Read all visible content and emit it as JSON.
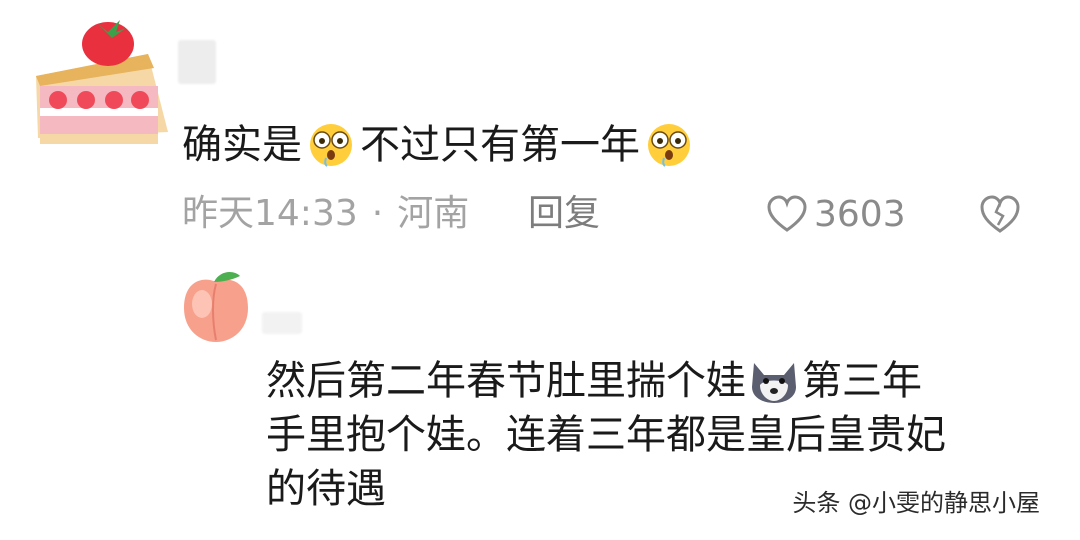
{
  "comment": {
    "avatar_icon": "strawberry-cake-icon",
    "text_parts": [
      "确实是",
      "不过只有第一年"
    ],
    "emoji_icon": "drooling-face-emoji",
    "time": "昨天14:33",
    "separator": "·",
    "location": "河南",
    "reply_label": "回复",
    "like_count": "3603",
    "colors": {
      "meta": "#a3a3a3",
      "text": "#1a1a1a"
    }
  },
  "reply": {
    "avatar_icon": "peach-icon",
    "lines": [
      [
        "然后第二年春节肚里揣个娃",
        "第三年"
      ],
      [
        "手里抱个娃。连着三年都是皇后皇贵妃"
      ],
      [
        "的待遇"
      ]
    ],
    "emoji_icon": "wolf-emoji"
  },
  "watermark": "头条 @小雯的静思小屋"
}
